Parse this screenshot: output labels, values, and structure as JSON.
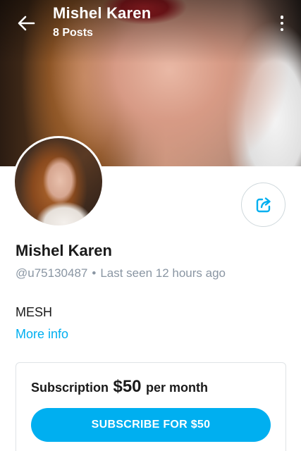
{
  "header": {
    "title": "Mishel Karen",
    "posts_count": "8 Posts",
    "back_icon": "arrow-left-icon",
    "menu_icon": "more-vertical-icon"
  },
  "profile": {
    "name": "Mishel Karen",
    "username": "@u75130487",
    "separator": "•",
    "last_seen": "Last seen 12 hours ago",
    "bio": "MESH",
    "more_info": "More info",
    "share_icon": "share-icon"
  },
  "subscription": {
    "label": "Subscription",
    "price": "$50",
    "period": "per month",
    "button_label": "SUBSCRIBE FOR $50"
  },
  "colors": {
    "accent": "#00aff0",
    "muted_text": "#8a96a3",
    "card_border": "#dfe3e6"
  }
}
